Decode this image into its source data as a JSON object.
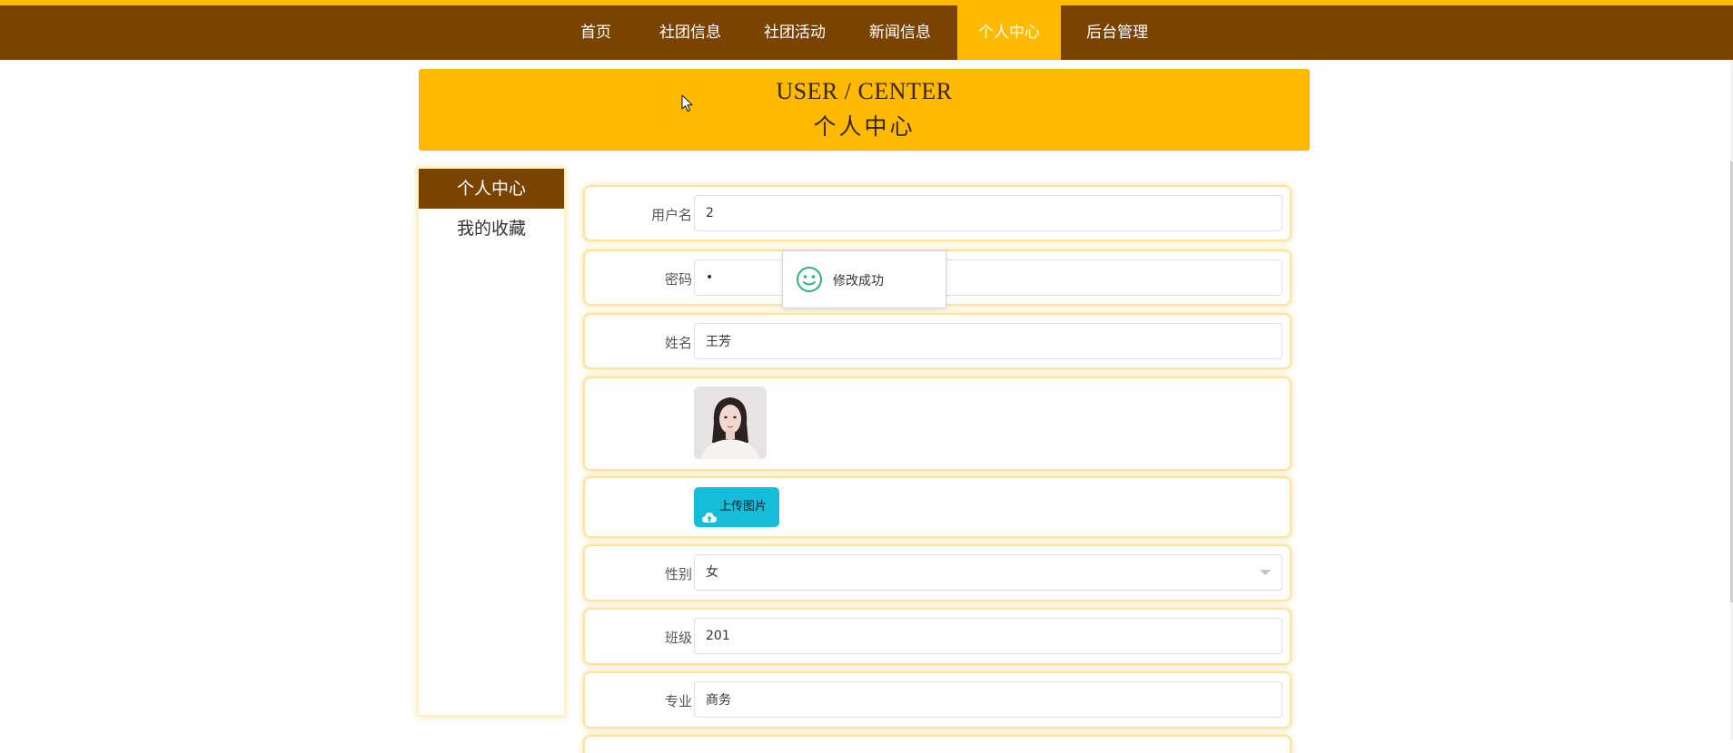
{
  "nav": {
    "items": [
      {
        "label": "首页"
      },
      {
        "label": "社团信息"
      },
      {
        "label": "社团活动"
      },
      {
        "label": "新闻信息"
      },
      {
        "label": "个人中心",
        "active": true
      },
      {
        "label": "后台管理"
      }
    ]
  },
  "banner": {
    "title_en": "USER / CENTER",
    "title_cn": "个人中心"
  },
  "sidebar": {
    "items": [
      {
        "label": "个人中心",
        "active": true
      },
      {
        "label": "我的收藏"
      }
    ]
  },
  "form": {
    "username": {
      "label": "用户名",
      "value": "2"
    },
    "password": {
      "label": "密码",
      "value": "•"
    },
    "name": {
      "label": "姓名",
      "value": "王芳"
    },
    "upload": {
      "label": "上传图片"
    },
    "gender": {
      "label": "性别",
      "value": "女"
    },
    "class": {
      "label": "班级",
      "value": "201"
    },
    "major": {
      "label": "专业",
      "value": "商务"
    }
  },
  "toast": {
    "message": "修改成功"
  },
  "colors": {
    "nav_bg": "#7a4400",
    "accent": "#ffba00",
    "upload_btn": "#16bcd8",
    "toast_icon": "#2bb37e"
  }
}
